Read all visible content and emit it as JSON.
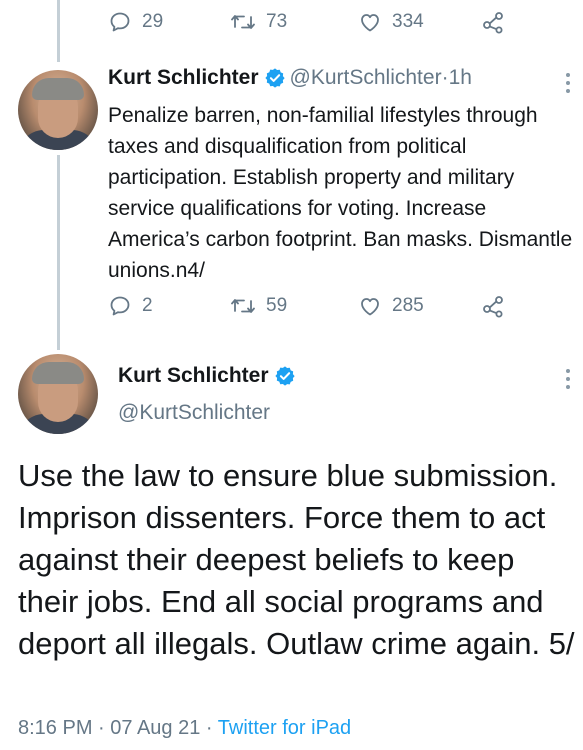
{
  "top_tweet_actions": {
    "replies": "29",
    "retweets": "73",
    "likes": "334"
  },
  "tweet1": {
    "name": "Kurt Schlichter",
    "handle": "@KurtSchlichter",
    "separator": " · ",
    "time": "1h",
    "text": "Penalize barren, non-familial lifestyles through taxes and disqualification from political participation. Establish property and military service qualifications for voting. Increase America’s carbon footprint. Ban masks. Dismantle unions.n4/",
    "actions": {
      "replies": "2",
      "retweets": "59",
      "likes": "285"
    }
  },
  "tweet2": {
    "name": "Kurt Schlichter",
    "handle": "@KurtSchlichter",
    "text": "Use the law to ensure blue submission. Imprison dissenters. Force them to act against their deepest beliefs to keep their jobs. End all social programs and deport all illegals. Outlaw crime again. 5/",
    "time": "8:16 PM",
    "date": "07 Aug 21",
    "source": "Twitter for iPad",
    "separator": " · "
  },
  "colors": {
    "accent": "#1da1f2",
    "muted": "#657786",
    "thread_line": "#c4cfd6",
    "text": "#14171a"
  },
  "icons": [
    "reply-icon",
    "retweet-icon",
    "like-icon",
    "share-icon",
    "verified-icon",
    "more-icon"
  ]
}
